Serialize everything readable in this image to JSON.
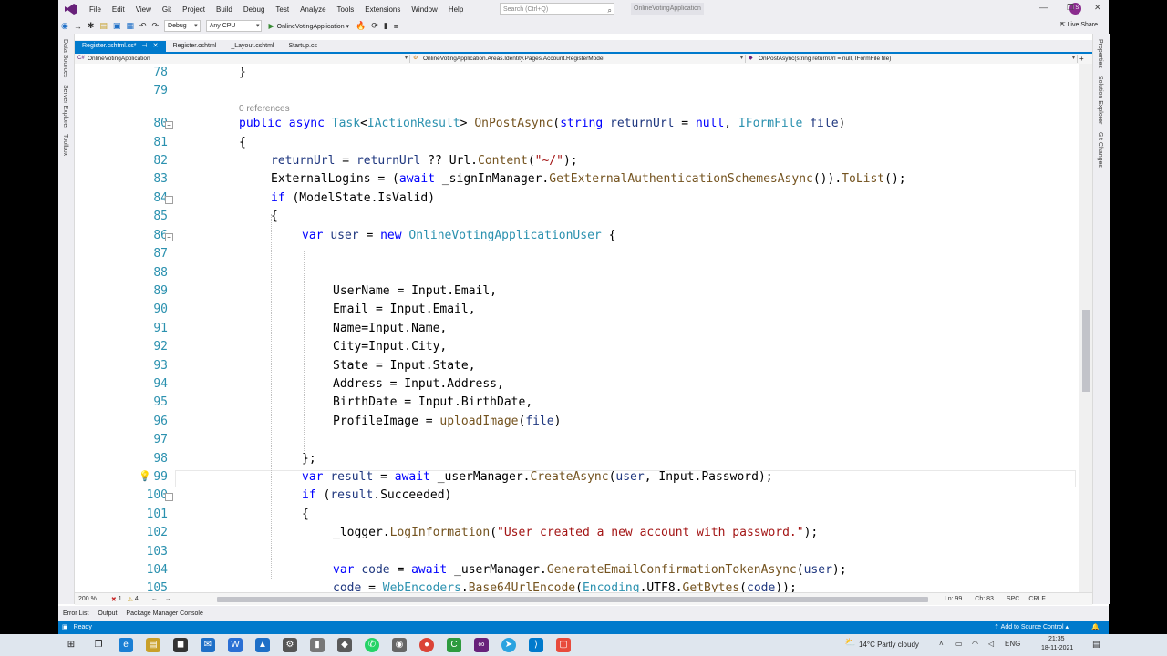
{
  "menu": {
    "items": [
      "File",
      "Edit",
      "View",
      "Git",
      "Project",
      "Build",
      "Debug",
      "Test",
      "Analyze",
      "Tools",
      "Extensions",
      "Window",
      "Help"
    ],
    "search_placeholder": "Search (Ctrl+Q)",
    "solution_name": "OnlineVotingApplication",
    "avatar_initials": "TS"
  },
  "toolbar": {
    "config": "Debug",
    "platform": "Any CPU",
    "run_target": "OnlineVotingApplication",
    "live_share": "Live Share"
  },
  "side_panels": {
    "left": [
      "Data Sources",
      "Server Explorer",
      "Toolbox"
    ],
    "right": [
      "Properties",
      "Solution Explorer",
      "Git Changes"
    ]
  },
  "tabs": [
    {
      "label": "Register.cshtml.cs*",
      "active": true
    },
    {
      "label": "Register.cshtml",
      "active": false
    },
    {
      "label": "_Layout.cshtml",
      "active": false
    },
    {
      "label": "Startup.cs",
      "active": false
    }
  ],
  "navbar": {
    "project": "OnlineVotingApplication",
    "class": "OnlineVotingApplication.Areas.Identity.Pages.Account.RegisterModel",
    "member": "OnPostAsync(string returnUrl = null, IFormFile file)"
  },
  "code": {
    "references": "0 references",
    "line_numbers": [
      "78",
      "79",
      "80",
      "81",
      "82",
      "83",
      "84",
      "85",
      "86",
      "87",
      "88",
      "89",
      "90",
      "91",
      "92",
      "93",
      "94",
      "95",
      "96",
      "97",
      "98",
      "99",
      "100",
      "101",
      "102",
      "103",
      "104",
      "105"
    ]
  },
  "editor_footer": {
    "zoom": "200 %",
    "errors": "1",
    "warnings": "4",
    "line": "Ln: 99",
    "char": "Ch: 83",
    "spc": "SPC",
    "crlf": "CRLF"
  },
  "bottom_tabs": [
    "Error List",
    "Output",
    "Package Manager Console"
  ],
  "status": {
    "ready": "Ready",
    "source_control": "Add to Source Control"
  },
  "taskbar": {
    "weather": "14°C  Partly cloudy",
    "time": "21:35",
    "date": "18-11-2021"
  },
  "colors": {
    "accent": "#007acc",
    "keyword": "#0000ff",
    "type": "#2b91af",
    "method": "#74531f",
    "string": "#a31515"
  }
}
